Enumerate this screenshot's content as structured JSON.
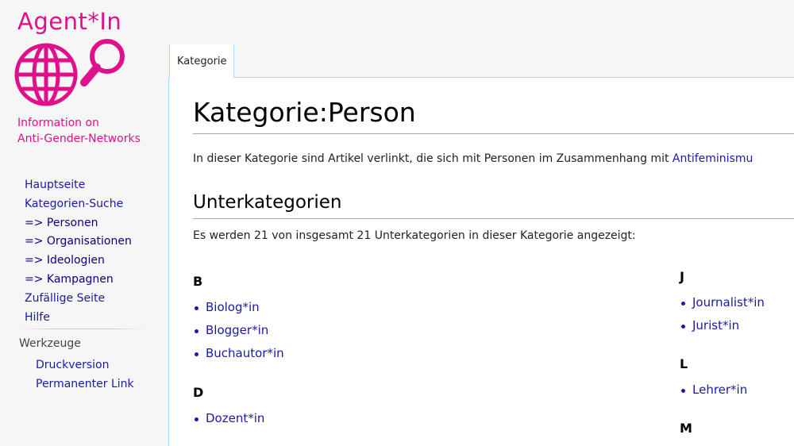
{
  "brand": {
    "title": "Agent*In",
    "subtitle_line1": "Information on",
    "subtitle_line2": "Anti-Gender-Networks",
    "color": "#e0108a",
    "logo_icon": "globe-magnifier-icon"
  },
  "sidebar": {
    "nav": [
      {
        "label": "Hauptseite"
      },
      {
        "label": "Kategorien-Suche"
      },
      {
        "label": "=> Personen"
      },
      {
        "label": "=> Organisationen"
      },
      {
        "label": "=> Ideologien"
      },
      {
        "label": "=> Kampagnen"
      },
      {
        "label": "Zufällige Seite"
      },
      {
        "label": "Hilfe"
      }
    ],
    "tools_heading": "Werkzeuge",
    "tools": [
      {
        "label": "Druckversion"
      },
      {
        "label": "Permanenter Link"
      }
    ]
  },
  "tabs": [
    {
      "label": "Kategorie"
    }
  ],
  "page": {
    "title": "Kategorie:Person",
    "intro_text": "In dieser Kategorie sind Artikel verlinkt, die sich mit Personen im Zusammenhang mit ",
    "intro_link": "Antifeminismu",
    "section_title": "Unterkategorien",
    "count_text": "Es werden 21 von insgesamt 21 Unterkategorien in dieser Kategorie angezeigt:"
  },
  "groups": [
    {
      "letter": "B",
      "items": [
        "Biolog*in",
        "Blogger*in",
        "Buchautor*in"
      ]
    },
    {
      "letter": "D",
      "items": [
        "Dozent*in"
      ]
    },
    {
      "letter": "J",
      "items": [
        "Journalist*in",
        "Jurist*in"
      ]
    },
    {
      "letter": "L",
      "items": [
        "Lehrer*in"
      ]
    },
    {
      "letter": "M",
      "items": []
    }
  ],
  "colors": {
    "link": "#1a1aa6",
    "tab_border": "#a7d7f9",
    "background": "#f6f6f6"
  }
}
